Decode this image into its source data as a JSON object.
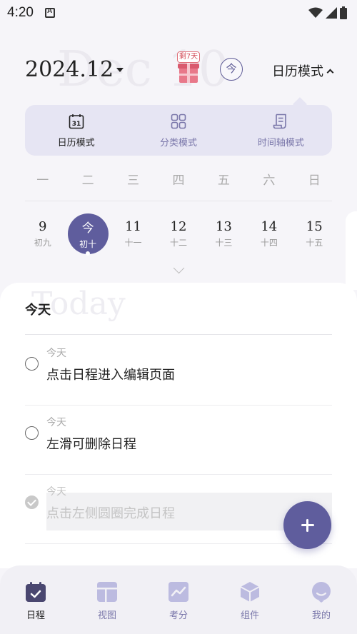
{
  "status_bar": {
    "time": "4:20"
  },
  "watermarks": {
    "month": "Dec 10",
    "today": "Today"
  },
  "header": {
    "month": "2024.12",
    "gift_badge": "剩7天",
    "today_button": "今",
    "mode_toggle": "日历模式"
  },
  "view_modes": [
    {
      "label": "日历模式",
      "icon": "calendar-31-icon",
      "active": true
    },
    {
      "label": "分类模式",
      "icon": "grid-icon",
      "active": false
    },
    {
      "label": "时间轴模式",
      "icon": "scroll-icon",
      "active": false
    }
  ],
  "calendar": {
    "weekdays": [
      "一",
      "二",
      "三",
      "四",
      "五",
      "六",
      "日"
    ],
    "days": [
      {
        "num": "9",
        "lunar": "初九"
      },
      {
        "num": "今",
        "lunar": "初十",
        "selected": true
      },
      {
        "num": "11",
        "lunar": "十一"
      },
      {
        "num": "12",
        "lunar": "十二"
      },
      {
        "num": "13",
        "lunar": "十三"
      },
      {
        "num": "14",
        "lunar": "十四"
      },
      {
        "num": "15",
        "lunar": "十五"
      }
    ]
  },
  "section": {
    "title": "今天"
  },
  "tasks": [
    {
      "date": "今天",
      "title": "点击日程进入编辑页面",
      "done": false
    },
    {
      "date": "今天",
      "title": "左滑可删除日程",
      "done": false
    },
    {
      "date": "今天",
      "title": "点击左侧圆圈完成日程",
      "done": true
    }
  ],
  "bottom_nav": [
    {
      "label": "日程",
      "icon": "calendar-icon",
      "active": true
    },
    {
      "label": "视图",
      "icon": "layout-icon",
      "active": false
    },
    {
      "label": "考分",
      "icon": "chart-icon",
      "active": false
    },
    {
      "label": "组件",
      "icon": "cube-icon",
      "active": false
    },
    {
      "label": "我的",
      "icon": "profile-icon",
      "active": false
    }
  ],
  "colors": {
    "accent": "#5f5d9d",
    "accent_light": "#e6e5f3",
    "gift": "#e06a78",
    "highlight": "#ffe7b0"
  }
}
